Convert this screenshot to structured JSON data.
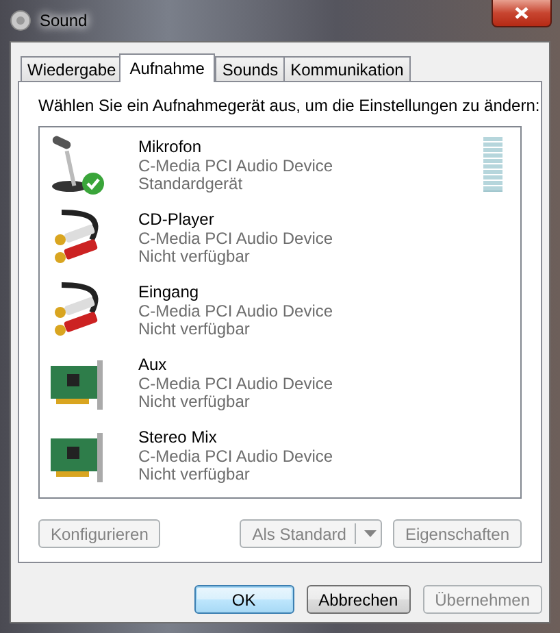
{
  "window": {
    "title": "Sound"
  },
  "tabs": [
    {
      "label": "Wiedergabe",
      "selected": false
    },
    {
      "label": "Aufnahme",
      "selected": true
    },
    {
      "label": "Sounds",
      "selected": false
    },
    {
      "label": "Kommunikation",
      "selected": false
    }
  ],
  "instruction": "Wählen Sie ein Aufnahmegerät aus, um die Einstellungen zu ändern:",
  "devices": [
    {
      "kind": "microphone",
      "name": "Mikrofon",
      "device": "C-Media PCI Audio Device",
      "status": "Standardgerät",
      "default": true,
      "meter": {
        "level": 0
      }
    },
    {
      "kind": "cable",
      "name": "CD-Player",
      "device": "C-Media PCI Audio Device",
      "status": "Nicht verfügbar",
      "default": false
    },
    {
      "kind": "cable",
      "name": "Eingang",
      "device": "C-Media PCI Audio Device",
      "status": "Nicht verfügbar",
      "default": false
    },
    {
      "kind": "card",
      "name": "Aux",
      "device": "C-Media PCI Audio Device",
      "status": "Nicht verfügbar",
      "default": false
    },
    {
      "kind": "card",
      "name": "Stereo Mix",
      "device": "C-Media PCI Audio Device",
      "status": "Nicht verfügbar",
      "default": false
    }
  ],
  "panel_buttons": [
    {
      "kind": "plain",
      "label": "Konfigurieren",
      "disabled": true
    },
    {
      "kind": "split",
      "label": "Als Standard",
      "disabled": true
    },
    {
      "kind": "plain",
      "label": "Eigenschaften",
      "disabled": true
    }
  ],
  "dialog_buttons": [
    {
      "label": "OK",
      "disabled": false,
      "default": true
    },
    {
      "label": "Abbrechen",
      "disabled": false,
      "default": false
    },
    {
      "label": "Übernehmen",
      "disabled": true,
      "default": false
    }
  ]
}
